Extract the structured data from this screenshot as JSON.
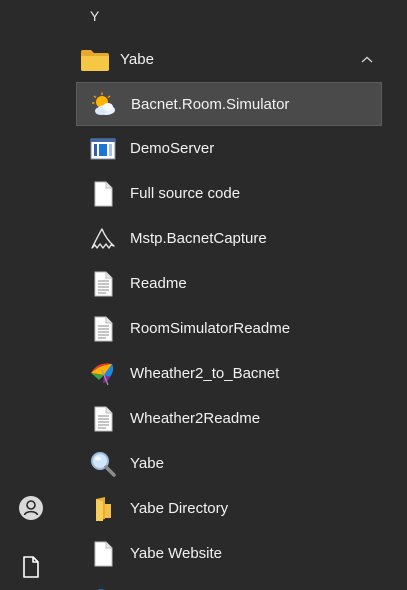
{
  "section_letter": "Y",
  "group": {
    "label": "Yabe",
    "expanded": true
  },
  "items": [
    {
      "label": "Bacnet.Room.Simulator",
      "icon": "weather-sun-cloud-icon",
      "selected": true
    },
    {
      "label": "DemoServer",
      "icon": "server-window-icon",
      "selected": false
    },
    {
      "label": "Full source code",
      "icon": "blank-file-icon",
      "selected": false
    },
    {
      "label": "Mstp.BacnetCapture",
      "icon": "shark-fin-icon",
      "selected": false
    },
    {
      "label": "Readme",
      "icon": "text-document-icon",
      "selected": false
    },
    {
      "label": "RoomSimulatorReadme",
      "icon": "text-document-icon",
      "selected": false
    },
    {
      "label": "Wheather2_to_Bacnet",
      "icon": "umbrella-icon",
      "selected": false
    },
    {
      "label": "Wheather2Readme",
      "icon": "text-document-icon",
      "selected": false
    },
    {
      "label": "Yabe",
      "icon": "magnifier-icon",
      "selected": false
    },
    {
      "label": "Yabe Directory",
      "icon": "folder-shortcut-icon",
      "selected": false
    },
    {
      "label": "Yabe Website",
      "icon": "blank-file-icon",
      "selected": false
    }
  ],
  "colors": {
    "background": "#2a2a2a",
    "selected_bg": "#4a4a4a",
    "text": "#f2f2f2",
    "folder": "#f5c33b"
  }
}
